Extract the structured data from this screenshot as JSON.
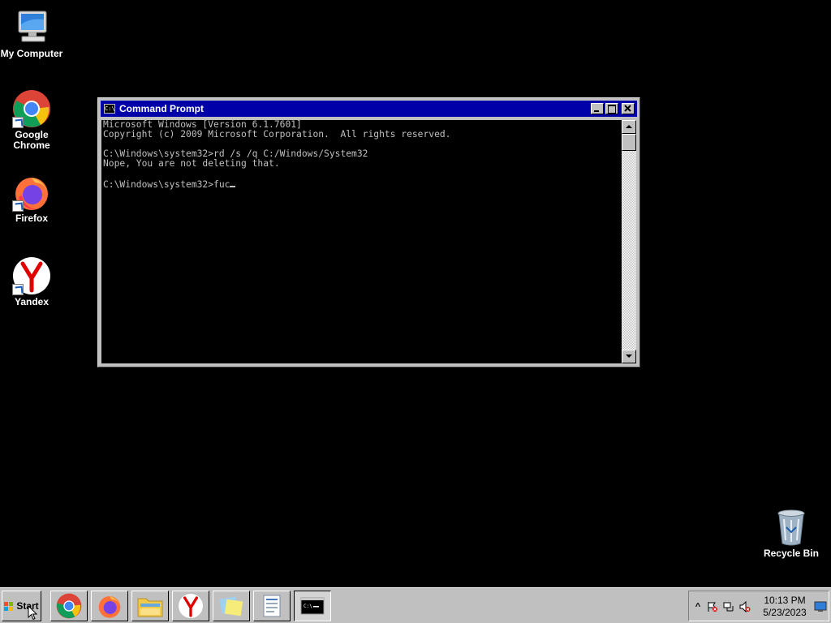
{
  "desktop": {
    "background_color": "#000000",
    "icons": [
      {
        "label": "My Computer",
        "icon": "computer-icon"
      },
      {
        "label": "Google Chrome",
        "icon": "chrome-icon"
      },
      {
        "label": "Firefox",
        "icon": "firefox-icon"
      },
      {
        "label": "Yandex",
        "icon": "yandex-icon"
      },
      {
        "label": "Recycle Bin",
        "icon": "recycle-bin-icon"
      }
    ]
  },
  "window": {
    "title": "Command Prompt",
    "icon": "cmd-icon",
    "title_bar_color": "#0000a8",
    "buttons": {
      "minimize": "_",
      "maximize": "□",
      "close": "✕"
    },
    "console_lines": [
      "Microsoft Windows [Version 6.1.7601]",
      "Copyright (c) 2009 Microsoft Corporation.  All rights reserved.",
      "",
      "C:\\Windows\\system32>rd /s /q C:/Windows/System32",
      "Nope, You are not deleting that.",
      ""
    ],
    "prompt": "C:\\Windows\\system32>",
    "input": "fuc"
  },
  "taskbar": {
    "start_label": "Start",
    "apps": [
      {
        "name": "chrome",
        "icon": "chrome-icon",
        "active": false
      },
      {
        "name": "firefox",
        "icon": "firefox-icon",
        "active": false
      },
      {
        "name": "explorer",
        "icon": "folder-icon",
        "active": false
      },
      {
        "name": "yandex",
        "icon": "yandex-icon",
        "active": false
      },
      {
        "name": "sticky-notes",
        "icon": "sticky-notes-icon",
        "active": false
      },
      {
        "name": "wordpad",
        "icon": "wordpad-icon",
        "active": false
      },
      {
        "name": "command-prompt",
        "icon": "cmd-icon",
        "active": true
      }
    ],
    "tray": {
      "show_hidden_label": "^",
      "icons": [
        "action-center-icon",
        "network-icon",
        "volume-muted-icon",
        "show-desktop-icon"
      ],
      "time": "10:13 PM",
      "date": "5/23/2023"
    }
  }
}
